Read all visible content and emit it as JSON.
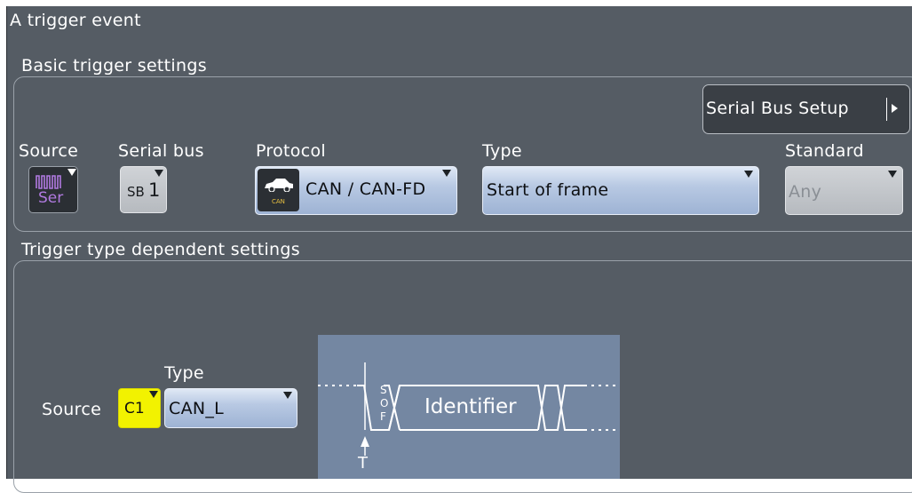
{
  "window_title": "A trigger event",
  "basic": {
    "heading": "Basic trigger settings",
    "setup_button": "Serial Bus Setup",
    "source": {
      "label": "Source",
      "icon_text": "Ser"
    },
    "serial_bus": {
      "label": "Serial bus",
      "prefix": "SB",
      "number": "1"
    },
    "protocol": {
      "label": "Protocol",
      "value": "CAN / CAN-FD",
      "icon_caption": "CAN"
    },
    "type": {
      "label": "Type",
      "value": "Start of frame"
    },
    "standard": {
      "label": "Standard",
      "value": "Any"
    }
  },
  "dependent": {
    "heading": "Trigger type dependent settings",
    "source_label": "Source",
    "channel": "C1",
    "type_label": "Type",
    "type_value": "CAN_L",
    "diagram": {
      "sof_letters": [
        "S",
        "O",
        "F"
      ],
      "field_label": "Identifier",
      "trigger_marker": "T"
    }
  },
  "colors": {
    "panel_bg": "#555c64",
    "field_blue": "#b8c9e3",
    "channel_yellow": "#f2f200",
    "serial_purple": "#b07ae0",
    "diagram_bg": "#7487a2"
  }
}
